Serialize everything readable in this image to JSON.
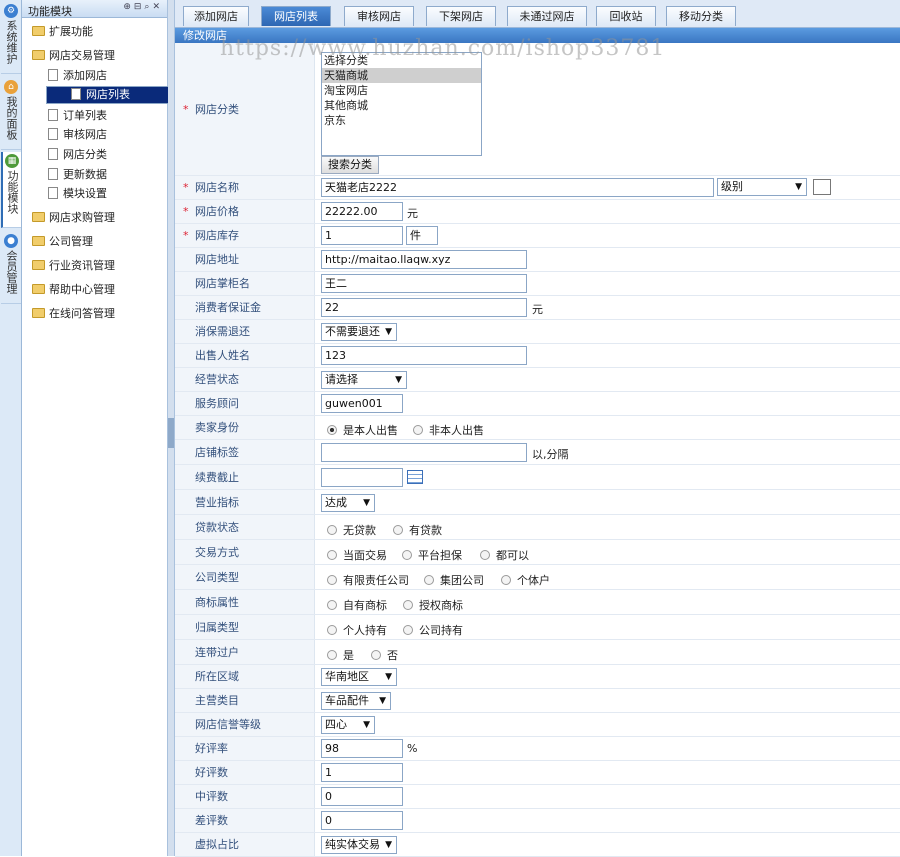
{
  "vtabs": [
    {
      "label": "系统维护",
      "icon": "gear-icon"
    },
    {
      "label": "我的面板",
      "icon": "home-icon"
    },
    {
      "label": "功能模块",
      "icon": "module-icon"
    },
    {
      "label": "会员管理",
      "icon": "user-icon"
    }
  ],
  "tree": {
    "title": "功能模块",
    "nodes": [
      {
        "label": "扩展功能",
        "type": "folder"
      },
      {
        "label": "网店交易管理",
        "type": "folder"
      },
      {
        "label": "添加网店",
        "type": "file"
      },
      {
        "label": "网店列表",
        "type": "file",
        "selected": true
      },
      {
        "label": "订单列表",
        "type": "file"
      },
      {
        "label": "审核网店",
        "type": "file"
      },
      {
        "label": "网店分类",
        "type": "file"
      },
      {
        "label": "更新数据",
        "type": "file"
      },
      {
        "label": "模块设置",
        "type": "file"
      },
      {
        "label": "网店求购管理",
        "type": "folder"
      },
      {
        "label": "公司管理",
        "type": "folder"
      },
      {
        "label": "行业资讯管理",
        "type": "folder"
      },
      {
        "label": "帮助中心管理",
        "type": "folder"
      },
      {
        "label": "在线问答管理",
        "type": "folder"
      }
    ]
  },
  "tabs": [
    "添加网店",
    "网店列表",
    "审核网店",
    "下架网店",
    "未通过网店",
    "回收站",
    "移动分类"
  ],
  "active_tab": "网店列表",
  "section_title": "修改网店",
  "watermark": "https://www.huzhan.com/ishop33781",
  "form": {
    "category": {
      "label": "网店分类",
      "options": [
        "选择分类",
        "天猫商城",
        "淘宝网店",
        "其他商城",
        "京东"
      ],
      "selected": "天猫商城",
      "search_button": "搜索分类"
    },
    "name": {
      "label": "网店名称",
      "value": "天猫老店2222",
      "level_select": "级别"
    },
    "price": {
      "label": "网店价格",
      "value": "22222.00",
      "unit": "元"
    },
    "stock": {
      "label": "网店库存",
      "value": "1",
      "unit": "件"
    },
    "url": {
      "label": "网店地址",
      "value": "http://maitao.llaqw.xyz"
    },
    "owner": {
      "label": "网店掌柜名",
      "value": "王二"
    },
    "deposit": {
      "label": "消费者保证金",
      "value": "22",
      "unit": "元"
    },
    "refund": {
      "label": "消保需退还",
      "value": "不需要退还"
    },
    "seller_name": {
      "label": "出售人姓名",
      "value": "123"
    },
    "biz_status": {
      "label": "经营状态",
      "value": "请选择"
    },
    "advisor": {
      "label": "服务顾问",
      "value": "guwen001"
    },
    "seller_identity": {
      "label": "卖家身份",
      "options": [
        "是本人出售",
        "非本人出售"
      ],
      "selected": "是本人出售"
    },
    "tags": {
      "label": "店铺标签",
      "value": "",
      "hint": "以,分隔"
    },
    "renew": {
      "label": "续费截止",
      "value": ""
    },
    "biz_index": {
      "label": "营业指标",
      "value": "达成"
    },
    "loan": {
      "label": "贷款状态",
      "options": [
        "无贷款",
        "有贷款"
      ]
    },
    "trade_mode": {
      "label": "交易方式",
      "options": [
        "当面交易",
        "平台担保",
        "都可以"
      ]
    },
    "company_type": {
      "label": "公司类型",
      "options": [
        "有限责任公司",
        "集团公司",
        "个体户"
      ]
    },
    "trademark": {
      "label": "商标属性",
      "options": [
        "自有商标",
        "授权商标"
      ]
    },
    "ownership": {
      "label": "归属类型",
      "options": [
        "个人持有",
        "公司持有"
      ]
    },
    "transfer": {
      "label": "连带过户",
      "options": [
        "是",
        "否"
      ]
    },
    "region": {
      "label": "所在区域",
      "value": "华南地区"
    },
    "main_category": {
      "label": "主营类目",
      "value": "车品配件"
    },
    "credit_level": {
      "label": "网店信誉等级",
      "value": "四心"
    },
    "good_rate": {
      "label": "好评率",
      "value": "98",
      "unit": "%"
    },
    "good_count": {
      "label": "好评数",
      "value": "1"
    },
    "mid_count": {
      "label": "中评数",
      "value": "0"
    },
    "bad_count": {
      "label": "差评数",
      "value": "0"
    },
    "virtual_ratio": {
      "label": "虚拟占比",
      "value": "纯实体交易"
    }
  }
}
